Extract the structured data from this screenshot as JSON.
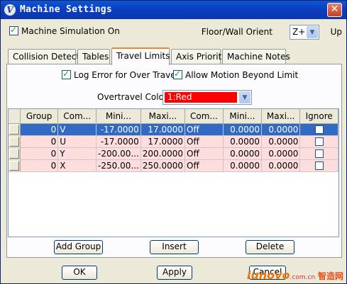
{
  "window": {
    "title": "Machine Settings",
    "close_glyph": "✕"
  },
  "header": {
    "sim_label": "Machine Simulation On",
    "sim_checked": true,
    "orient_label": "Floor/Wall Orient",
    "orient_value": "Z+",
    "up_label": "Up"
  },
  "tabs": [
    {
      "label": "Collision Detect",
      "active": false
    },
    {
      "label": "Tables",
      "active": false
    },
    {
      "label": "Travel Limits",
      "active": true
    },
    {
      "label": "Axis Priority",
      "active": false
    },
    {
      "label": "Machine Notes",
      "active": false
    }
  ],
  "options": {
    "log_error_label": "Log Error for Over Travel",
    "log_error_checked": true,
    "allow_motion_label": "Allow Motion Beyond Limit",
    "allow_motion_checked": true,
    "overtravel_label": "Overtravel Color",
    "overtravel_value": "1:Red",
    "overtravel_color": "#ff0000"
  },
  "table": {
    "columns": [
      "Group",
      "Com...",
      "Mini...",
      "Maxi...",
      "Com...",
      "Mini...",
      "Maxi...",
      "Ignore"
    ],
    "rows": [
      {
        "group": "0",
        "com1": "V",
        "min1": "-17.0000",
        "max1": "17.0000",
        "com2": "Off",
        "min2": "0.0000",
        "max2": "0.0000",
        "ignore": false,
        "selected": true
      },
      {
        "group": "0",
        "com1": "U",
        "min1": "-17.0000",
        "max1": "17.0000",
        "com2": "Off",
        "min2": "0.0000",
        "max2": "0.0000",
        "ignore": false,
        "selected": false
      },
      {
        "group": "0",
        "com1": "Y",
        "min1": "-200.00...",
        "max1": "200.0000",
        "com2": "Off",
        "min2": "0.0000",
        "max2": "0.0000",
        "ignore": false,
        "selected": false
      },
      {
        "group": "0",
        "com1": "X",
        "min1": "-250.00...",
        "max1": "250.0000",
        "com2": "Off",
        "min2": "0.0000",
        "max2": "0.0000",
        "ignore": false,
        "selected": false
      }
    ]
  },
  "buttons": {
    "add_group": "Add Group",
    "insert": "Insert",
    "delete": "Delete",
    "ok": "OK",
    "apply": "Apply",
    "cancel": "Cancel"
  },
  "watermark": {
    "brand": "lunovo",
    "site": ".com.cn",
    "cn": "智造网"
  }
}
